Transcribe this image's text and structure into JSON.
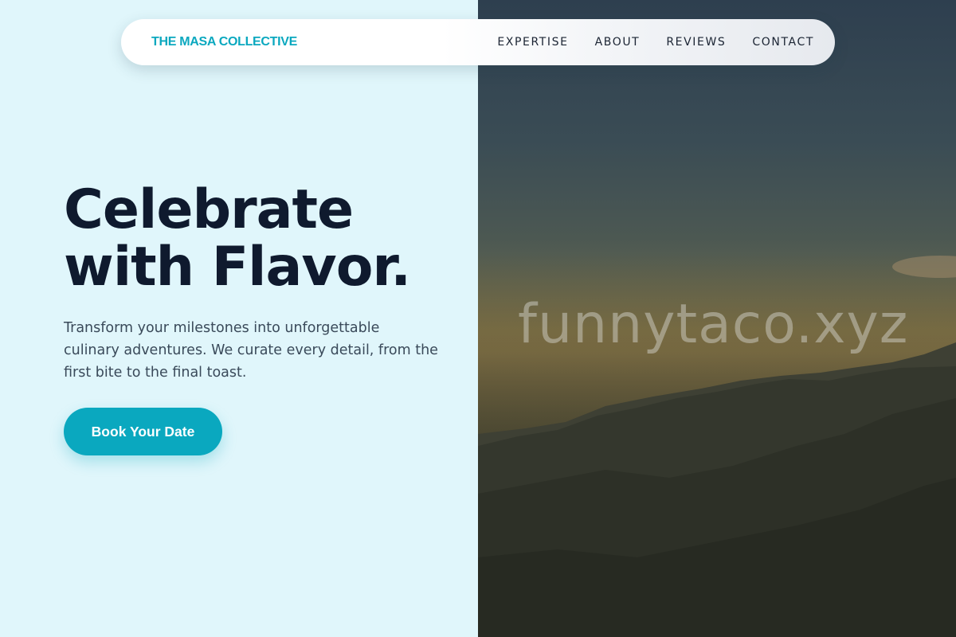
{
  "brand": {
    "name": "THE MASA COLLECTIVE"
  },
  "nav": {
    "items": [
      {
        "label": "EXPERTISE"
      },
      {
        "label": "ABOUT"
      },
      {
        "label": "REVIEWS"
      },
      {
        "label": "CONTACT"
      }
    ]
  },
  "hero": {
    "title_line1": "Celebrate",
    "title_line2": "with Flavor.",
    "description": "Transform your milestones into unforgettable culinary adventures. We curate every detail, from the first bite to the final toast.",
    "cta_label": "Book Your Date"
  },
  "image": {
    "watermark": "funnytaco.xyz",
    "subject": "mountain-sunset-photo"
  },
  "colors": {
    "accent": "#0aa8bf",
    "background": "#e0f6fb",
    "heading": "#0f1a2e",
    "body_text": "#3a4a5a"
  }
}
